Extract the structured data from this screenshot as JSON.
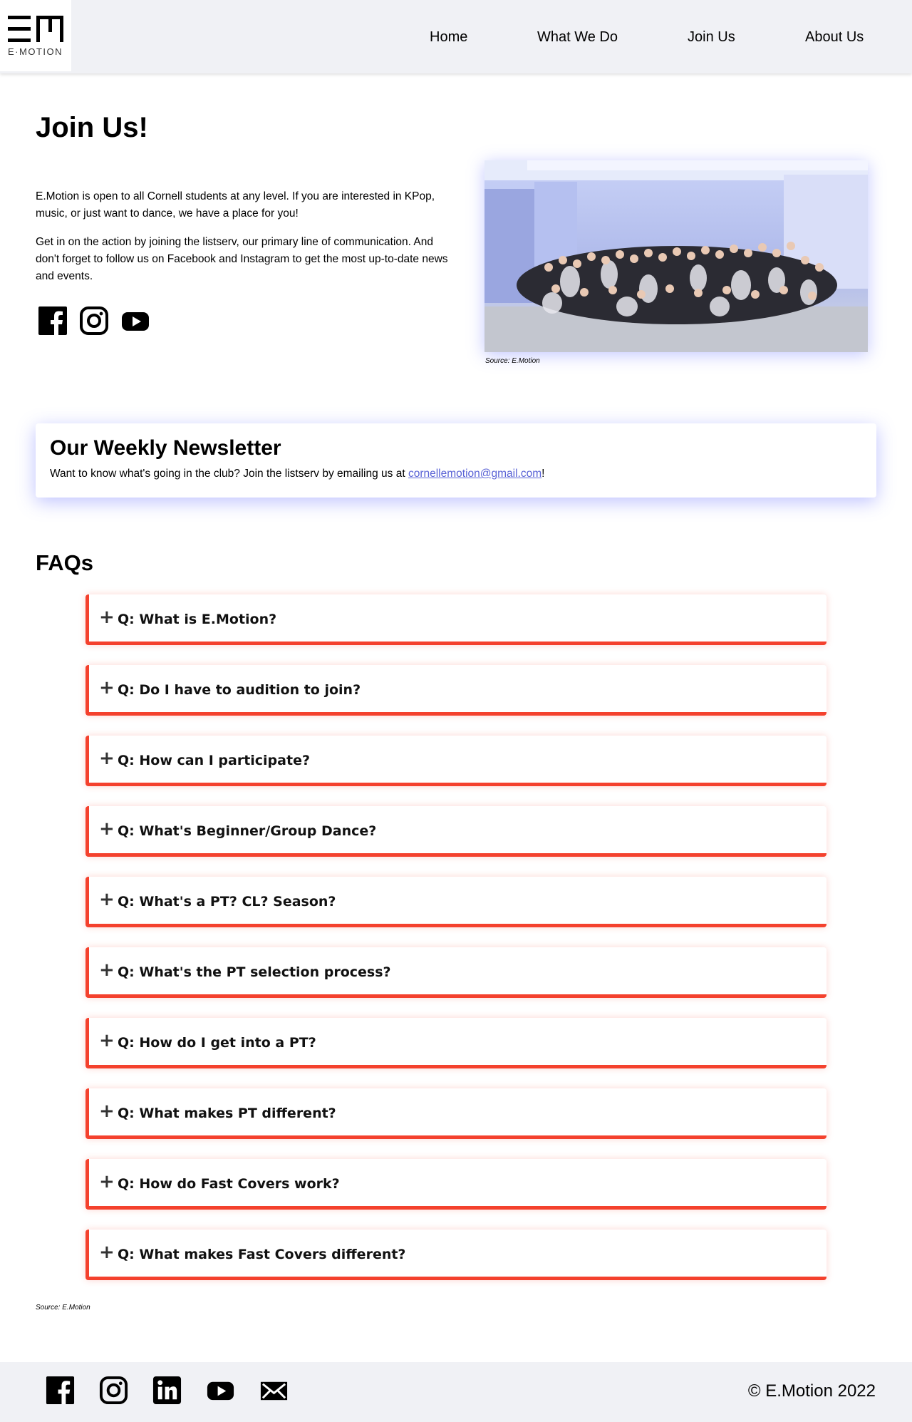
{
  "brand": {
    "logo_text": "E·MOTION"
  },
  "nav": {
    "links": [
      "Home",
      "What We Do",
      "Join Us",
      "About Us"
    ]
  },
  "join": {
    "title": "Join Us!",
    "paragraph_1": "E.Motion is open to all Cornell students at any level. If you are interested in KPop, music, or just want to dance, we have a place for you!",
    "paragraph_2": "Get in on the action by joining the listserv, our primary line of communication. And don't forget to follow us on Facebook and Instagram to get the most up-to-date news and events.",
    "social_icons": [
      "facebook-icon",
      "instagram-icon",
      "youtube-icon"
    ],
    "photo_caption": "Source: E.Motion"
  },
  "newsletter": {
    "title": "Our Weekly Newsletter",
    "text_before": "Want to know what's going in the club? Join the listserv by emailing us at ",
    "email": "cornellemotion@gmail.com",
    "text_after": "!"
  },
  "faq": {
    "title": "FAQs",
    "items": [
      "Q: What is E.Motion?",
      "Q: Do I have to audition to join?",
      "Q: How can I participate?",
      "Q: What's Beginner/Group Dance?",
      "Q: What's a PT? CL? Season?",
      "Q: What's the PT selection process?",
      "Q: How do I get into a PT?",
      "Q: What makes PT different?",
      "Q: How do Fast Covers work?",
      "Q: What makes Fast Covers different?"
    ],
    "caption": "Source: E.Motion"
  },
  "footer": {
    "social_icons": [
      "facebook-icon",
      "instagram-icon",
      "linkedin-icon",
      "youtube-icon",
      "mail-icon"
    ],
    "copyright": "© E.Motion 2022"
  },
  "colors": {
    "nav_bg": "#f0f1f5",
    "faq_accent": "#f4412d",
    "link": "#5a63d6",
    "newsletter_glow": "#6e78ff"
  }
}
